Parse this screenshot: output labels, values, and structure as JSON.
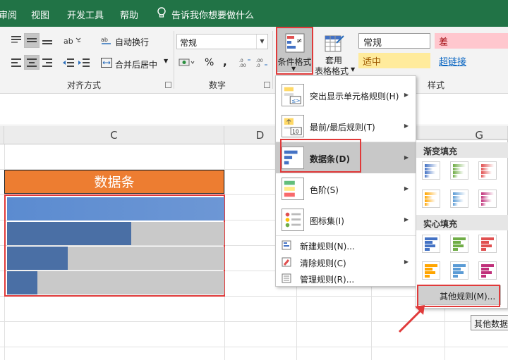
{
  "tabs": [
    "审阅",
    "视图",
    "开发工具",
    "帮助"
  ],
  "tell_me": "告诉我你想要做什么",
  "ribbon": {
    "wrap_text": "自动换行",
    "merge_center": "合并后居中",
    "number_format": "常规",
    "percent": "%",
    "comma": ",",
    "cond_format_line1": "条件格式",
    "table_format_line1": "套用",
    "table_format_line2": "表格格式",
    "styles": {
      "normal": "常规",
      "bad": "差",
      "neutral": "适中",
      "hyperlink": "超链接"
    },
    "group_labels": {
      "alignment": "对齐方式",
      "number": "数字",
      "styles": "样式"
    }
  },
  "grid": {
    "columns": [
      "C",
      "D",
      "G"
    ],
    "header_text": "数据条",
    "bar_values": [
      1.0,
      0.57,
      0.28,
      0.14
    ]
  },
  "menu": {
    "items": [
      {
        "label": "突出显示单元格规则(H)"
      },
      {
        "label": "最前/最后规则(T)"
      },
      {
        "label": "数据条(D)"
      },
      {
        "label": "色阶(S)"
      },
      {
        "label": "图标集(I)"
      }
    ],
    "small_items": [
      {
        "label": "新建规则(N)..."
      },
      {
        "label": "清除规则(C)"
      },
      {
        "label": "管理规则(R)..."
      }
    ]
  },
  "submenu": {
    "gradient_title": "渐变填充",
    "solid_title": "实心填充",
    "more_rules": "其他规则(M)...",
    "swatch_colors": [
      "#4472c4",
      "#70ad47",
      "#e05050",
      "#ffa500",
      "#5b9bd5",
      "#c0307a"
    ]
  },
  "tooltip": "其他数据"
}
